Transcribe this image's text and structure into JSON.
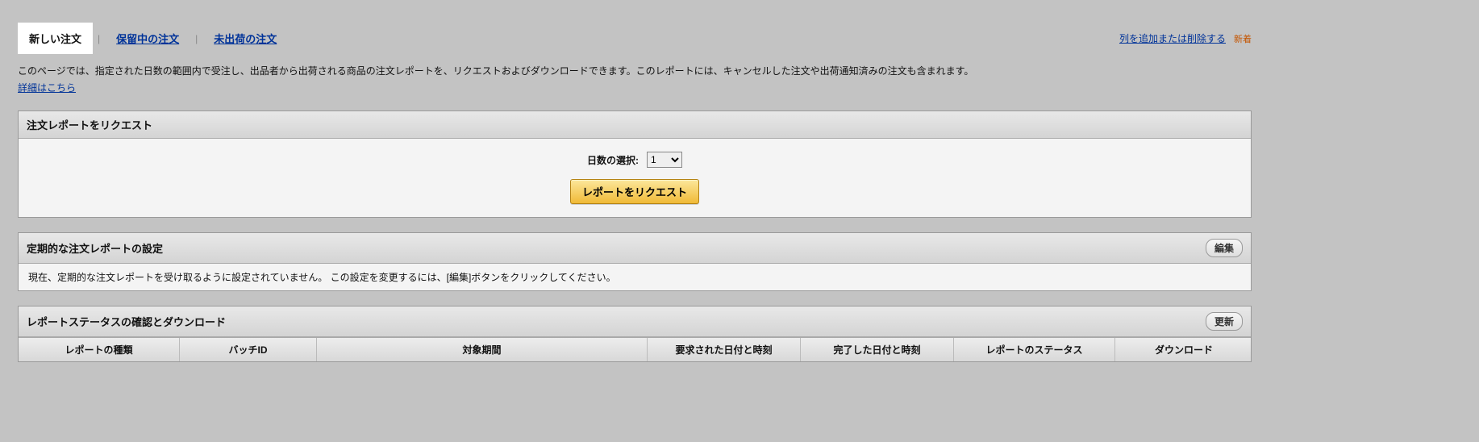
{
  "tabs": {
    "active": "新しい注文",
    "pending": "保留中の注文",
    "unshipped": "未出荷の注文"
  },
  "right": {
    "addremove": "列を追加または削除する",
    "badge": "新着"
  },
  "desc": {
    "text": "このページでは、指定された日数の範囲内で受注し、出品者から出荷される商品の注文レポートを、リクエストおよびダウンロードできます。このレポートには、キャンセルした注文や出荷通知済みの注文も含まれます。",
    "learn": "詳細はこちら"
  },
  "request": {
    "title": "注文レポートをリクエスト",
    "days_label": "日数の選択:",
    "days_value": "1",
    "btn": "レポートをリクエスト"
  },
  "scheduled": {
    "title": "定期的な注文レポートの設定",
    "edit": "編集",
    "msg": "現在、定期的な注文レポートを受け取るように設定されていません。 この設定を変更するには、[編集]ボタンをクリックしてください。"
  },
  "status": {
    "title": "レポートステータスの確認とダウンロード",
    "refresh": "更新",
    "cols": {
      "type": "レポートの種類",
      "batch": "バッチID",
      "period": "対象期間",
      "requested": "要求された日付と時刻",
      "completed": "完了した日付と時刻",
      "rstatus": "レポートのステータス",
      "download": "ダウンロード"
    }
  }
}
